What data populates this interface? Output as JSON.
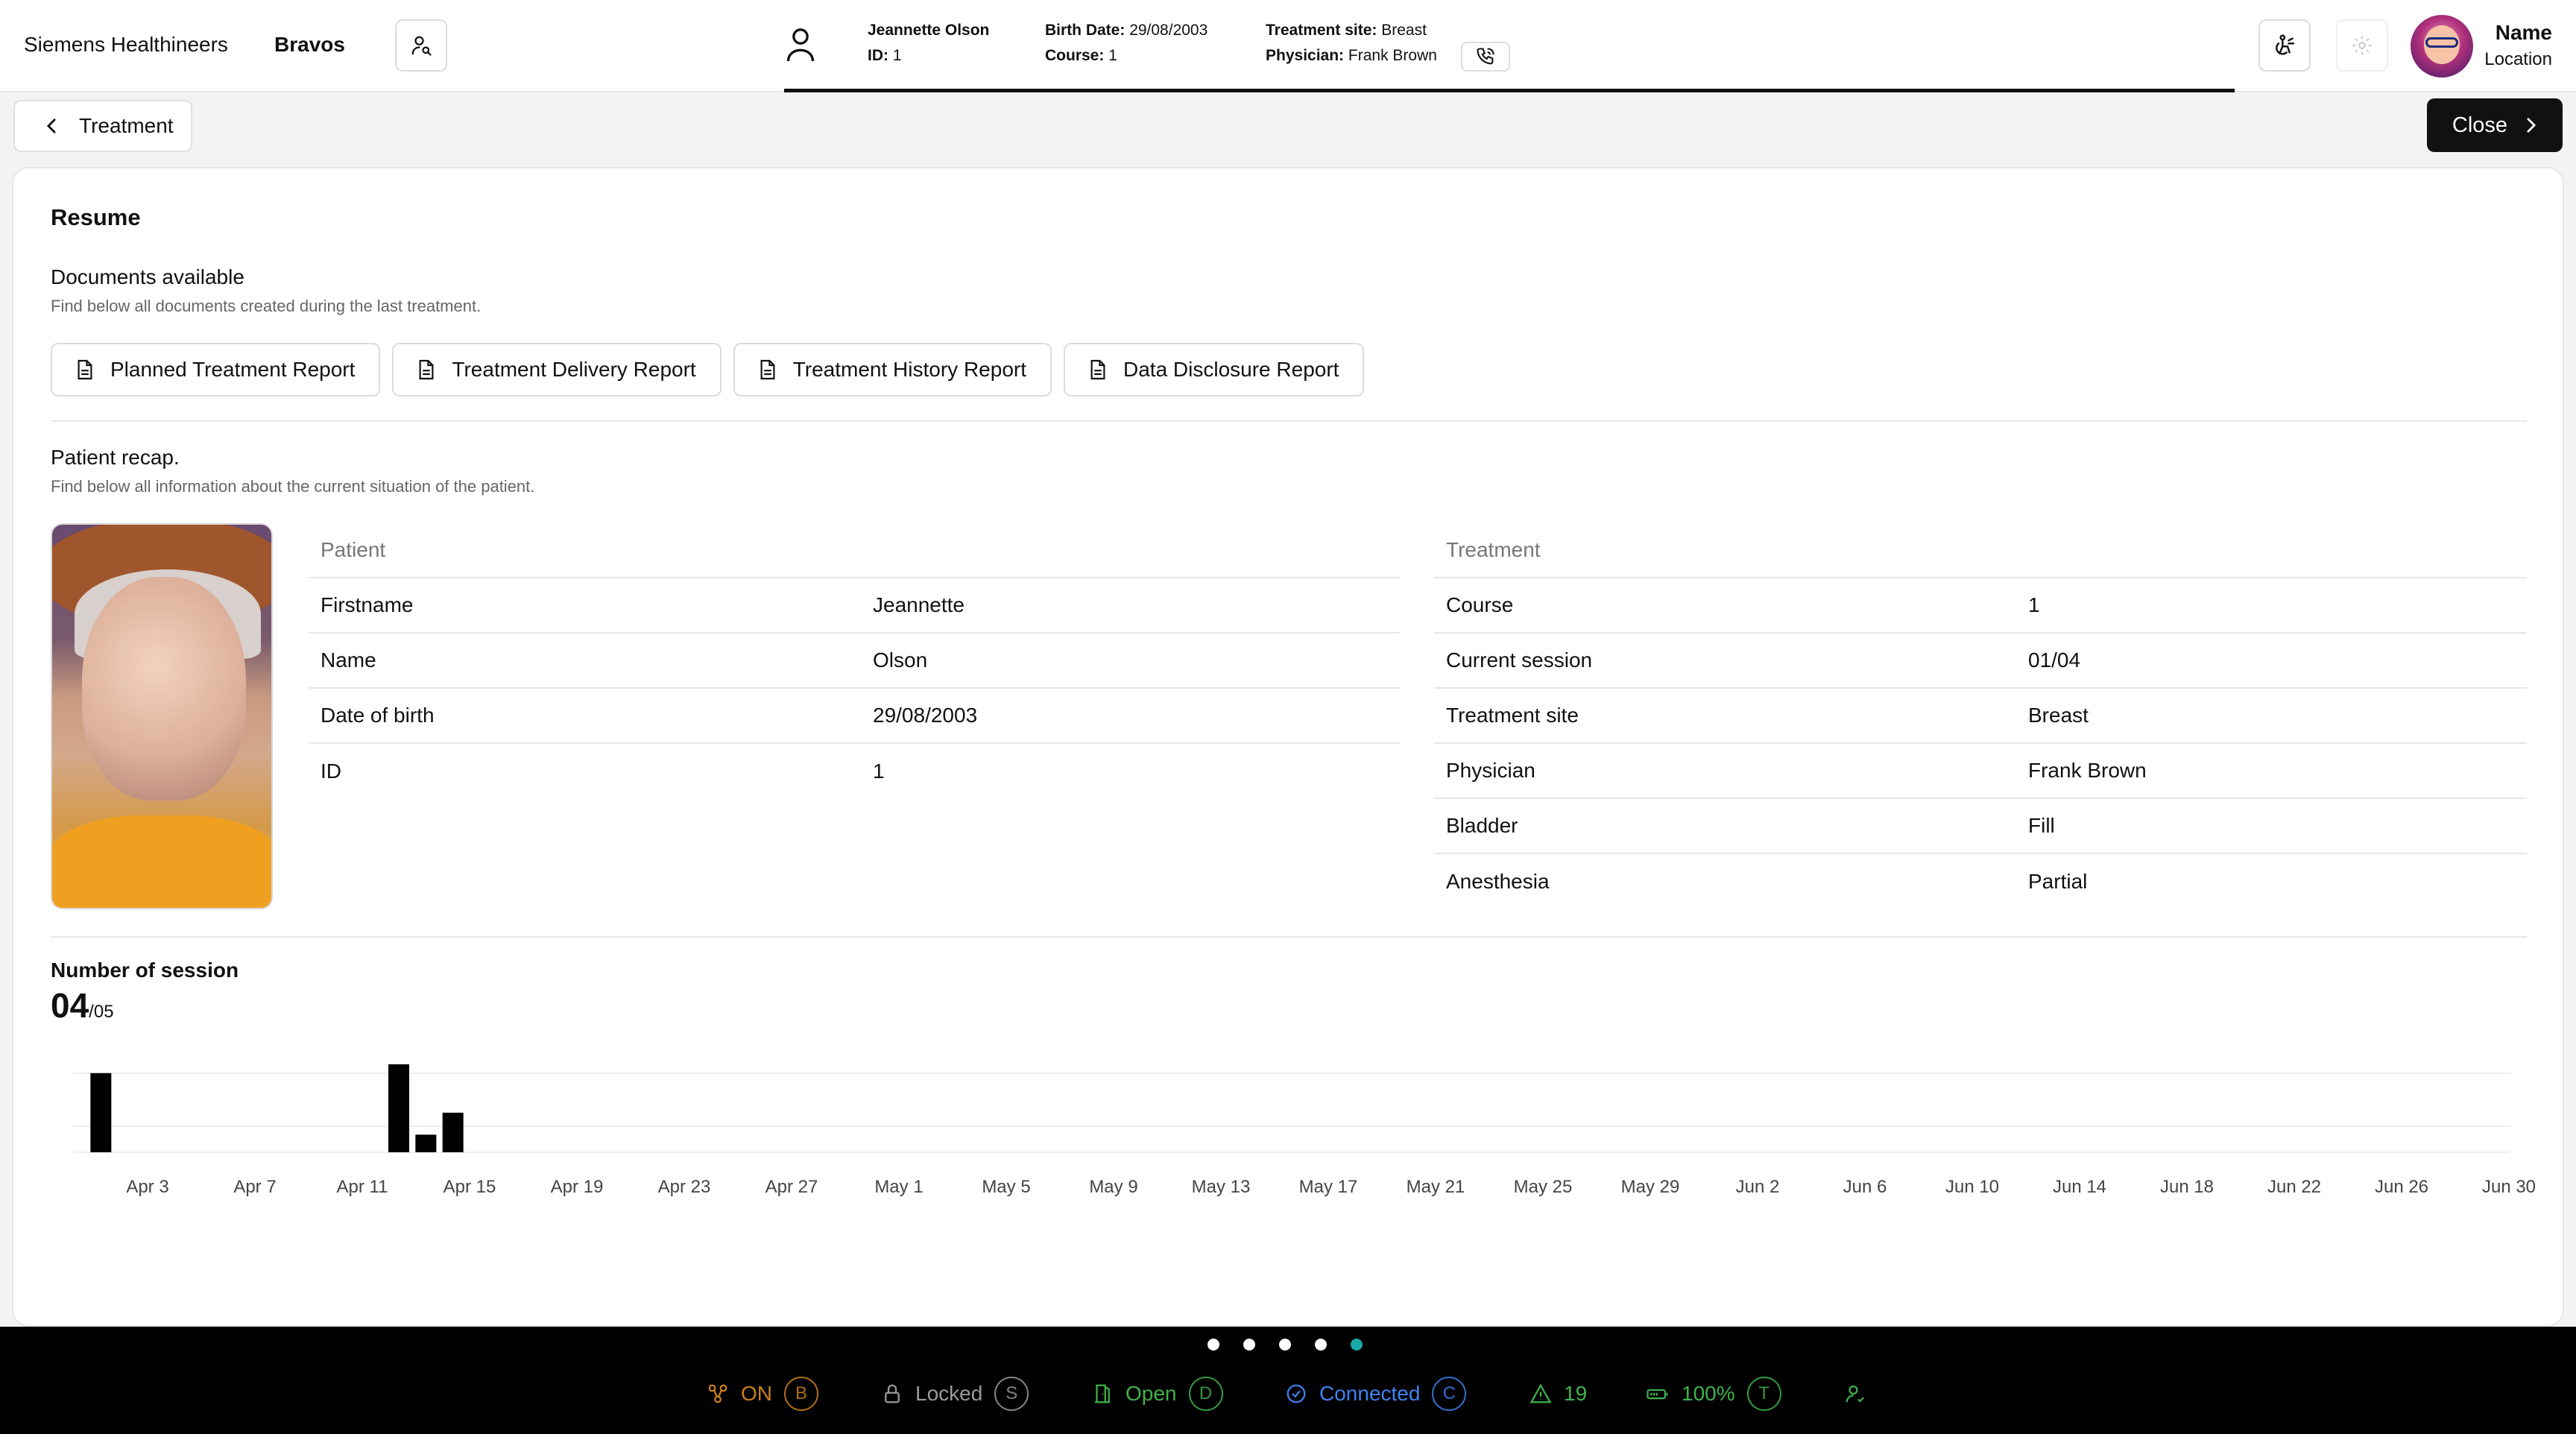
{
  "header": {
    "brand": "Siemens Healthineers",
    "product": "Bravos",
    "patient": {
      "name": "Jeannette Olson",
      "id_label": "ID:",
      "id_value": "1",
      "birth_label": "Birth Date:",
      "birth_value": "29/08/2003",
      "course_label": "Course:",
      "course_value": "1",
      "site_label": "Treatment site:",
      "site_value": "Breast",
      "physician_label": "Physician:",
      "physician_value": "Frank Brown"
    },
    "user": {
      "name": "Name",
      "location": "Location"
    }
  },
  "subheader": {
    "back_label": "Treatment",
    "close_label": "Close"
  },
  "resume": {
    "title": "Resume",
    "documents": {
      "heading": "Documents available",
      "description": "Find below all documents created during the last treatment.",
      "buttons": [
        "Planned Treatment Report",
        "Treatment Delivery Report",
        "Treatment History Report",
        "Data Disclosure Report"
      ]
    },
    "recap": {
      "heading": "Patient recap.",
      "description": "Find below all information about the current situation of the patient.",
      "patient": {
        "header": "Patient",
        "rows": [
          {
            "key": "Firstname",
            "value": "Jeannette"
          },
          {
            "key": "Name",
            "value": "Olson"
          },
          {
            "key": "Date of birth",
            "value": "29/08/2003"
          },
          {
            "key": "ID",
            "value": "1"
          }
        ]
      },
      "treatment": {
        "header": "Treatment",
        "rows": [
          {
            "key": "Course",
            "value": "1"
          },
          {
            "key": "Current session",
            "value": "01/04"
          },
          {
            "key": "Treatment site",
            "value": "Breast"
          },
          {
            "key": "Physician",
            "value": "Frank Brown"
          },
          {
            "key": "Bladder",
            "value": "Fill"
          },
          {
            "key": "Anesthesia",
            "value": "Partial"
          }
        ]
      }
    },
    "sessions": {
      "title": "Number of session",
      "count": "04",
      "total": "/05"
    }
  },
  "chart_data": {
    "type": "bar",
    "title": "Number of session",
    "x_ticks": [
      "Apr 3",
      "Apr 7",
      "Apr 11",
      "Apr 15",
      "Apr 19",
      "Apr 23",
      "Apr 27",
      "May 1",
      "May 5",
      "May 9",
      "May 13",
      "May 17",
      "May 21",
      "May 25",
      "May 29",
      "Jun 2",
      "Jun 6",
      "Jun 10",
      "Jun 14",
      "Jun 18",
      "Jun 22",
      "Jun 26",
      "Jun 30"
    ],
    "x": [
      "Apr 2",
      "Apr 13",
      "Apr 14",
      "Apr 15"
    ],
    "values": [
      0.9,
      1.0,
      0.2,
      0.45
    ],
    "ylim": [
      0,
      1
    ],
    "grid": true,
    "color": "#000000"
  },
  "statusbar": {
    "pages": 5,
    "active_page": 5,
    "items": [
      {
        "icon": "power-icon",
        "label": "ON",
        "key": "B",
        "color": "#c9801e"
      },
      {
        "icon": "lock-icon",
        "label": "Locked",
        "key": "S",
        "color": "#9a9a9a"
      },
      {
        "icon": "door-icon",
        "label": "Open",
        "key": "D",
        "color": "#3fb24a"
      },
      {
        "icon": "check-circle-icon",
        "label": "Connected",
        "key": "C",
        "color": "#3d82f0"
      },
      {
        "icon": "warning-icon",
        "label": "19",
        "key": "",
        "color": "#3fb24a"
      },
      {
        "icon": "battery-icon",
        "label": "100%",
        "key": "T",
        "color": "#3fb24a"
      },
      {
        "icon": "user-check-icon",
        "label": "",
        "key": "",
        "color": "#3fb24a"
      }
    ]
  }
}
